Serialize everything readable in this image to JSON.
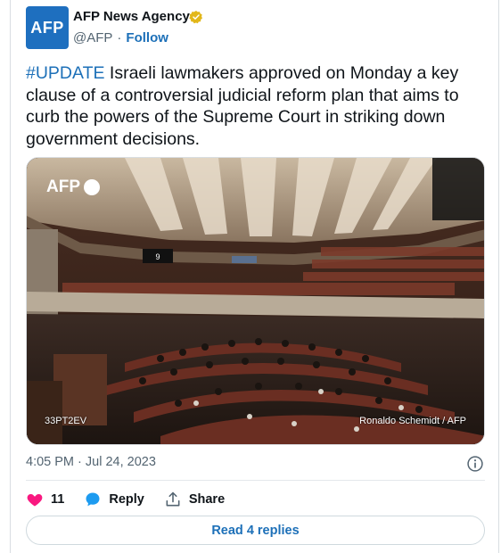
{
  "author": {
    "name": "AFP News Agency",
    "handle": "@AFP",
    "separator": "·",
    "follow_label": "Follow",
    "avatar_text": "AFP",
    "verified_color": "#e2b719"
  },
  "tweet": {
    "hashtag": "#UPDATE",
    "text": " Israeli lawmakers approved on Monday a key clause of a controversial judicial reform plan that aims to curb the powers of the Supreme Court in striking down government decisions."
  },
  "photo": {
    "logo_text": "AFP",
    "photo_id": "33PT2EV",
    "credit": "Ronaldo Schemidt / AFP",
    "screen_number": "9"
  },
  "meta": {
    "timestamp": "4:05 PM · Jul 24, 2023"
  },
  "actions": {
    "like_count": "11",
    "reply_label": "Reply",
    "share_label": "Share"
  },
  "footer": {
    "read_replies_label": "Read 4 replies"
  },
  "colors": {
    "link": "#1d70b8",
    "like": "#f91880",
    "reply": "#1d9bf0",
    "brand": "#1e6fbf"
  }
}
